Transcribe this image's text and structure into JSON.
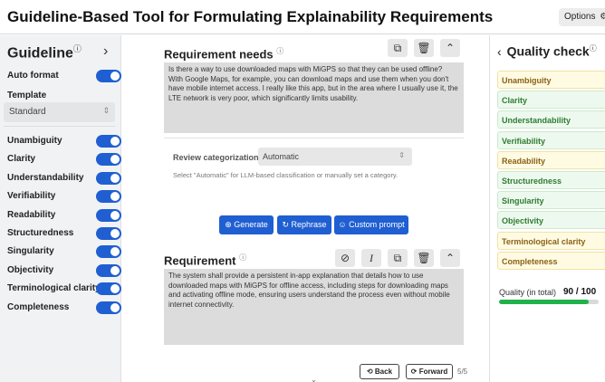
{
  "header": {
    "title": "Guideline-Based Tool for Formulating Explainability Requirements",
    "options_label": "Options"
  },
  "sidebar": {
    "title": "Guideline",
    "auto_format_label": "Auto format",
    "template_label": "Template",
    "template_value": "Standard",
    "toggles": [
      {
        "label": "Unambiguity",
        "on": true
      },
      {
        "label": "Clarity",
        "on": true
      },
      {
        "label": "Understandability",
        "on": true
      },
      {
        "label": "Verifiability",
        "on": true
      },
      {
        "label": "Readability",
        "on": true
      },
      {
        "label": "Structuredness",
        "on": true
      },
      {
        "label": "Singularity",
        "on": true
      },
      {
        "label": "Objectivity",
        "on": true
      },
      {
        "label": "Terminological clarity",
        "on": true
      },
      {
        "label": "Completeness",
        "on": true
      }
    ]
  },
  "needs": {
    "title": "Requirement needs",
    "text": "Is there a way to use downloaded maps with MiGPS so that they can be used offline?\nWith Google Maps, for example, you can download maps and use them when you don't have mobile internet access. I really like this app, but in the area where I usually use it, the LTE network is very poor, which significantly limits usability."
  },
  "review": {
    "label": "Review categorization:",
    "value": "Automatic",
    "help": "Select \"Automatic\" for LLM-based classification or manually set a category."
  },
  "actions": {
    "generate": "Generate",
    "rephrase": "Rephrase",
    "custom_prompt": "Custom prompt"
  },
  "requirement": {
    "title": "Requirement",
    "text": "The system shall provide a persistent in-app explanation that details how to use downloaded maps with MiGPS for offline access, including steps for downloading maps and activating offline mode, ensuring users understand the process even without mobile internet connectivity."
  },
  "nav": {
    "back": "Back",
    "forward": "Forward",
    "page": "5/5"
  },
  "quality": {
    "title": "Quality check",
    "items": [
      {
        "label": "Unambiguity",
        "status": "warning"
      },
      {
        "label": "Clarity",
        "status": "ok"
      },
      {
        "label": "Understandability",
        "status": "ok"
      },
      {
        "label": "Verifiability",
        "status": "ok"
      },
      {
        "label": "Readability",
        "status": "warning"
      },
      {
        "label": "Structuredness",
        "status": "ok"
      },
      {
        "label": "Singularity",
        "status": "ok"
      },
      {
        "label": "Objectivity",
        "status": "ok"
      },
      {
        "label": "Terminological clarity",
        "status": "warning"
      },
      {
        "label": "Completeness",
        "status": "warning"
      }
    ],
    "total_label": "Quality (in total)",
    "total_value": "90 / 100",
    "total_fraction": 0.9
  },
  "colors": {
    "accent": "#1f5fd1",
    "ok": "#2e7d32",
    "warning": "#8a6214",
    "progress": "#20b24a"
  }
}
